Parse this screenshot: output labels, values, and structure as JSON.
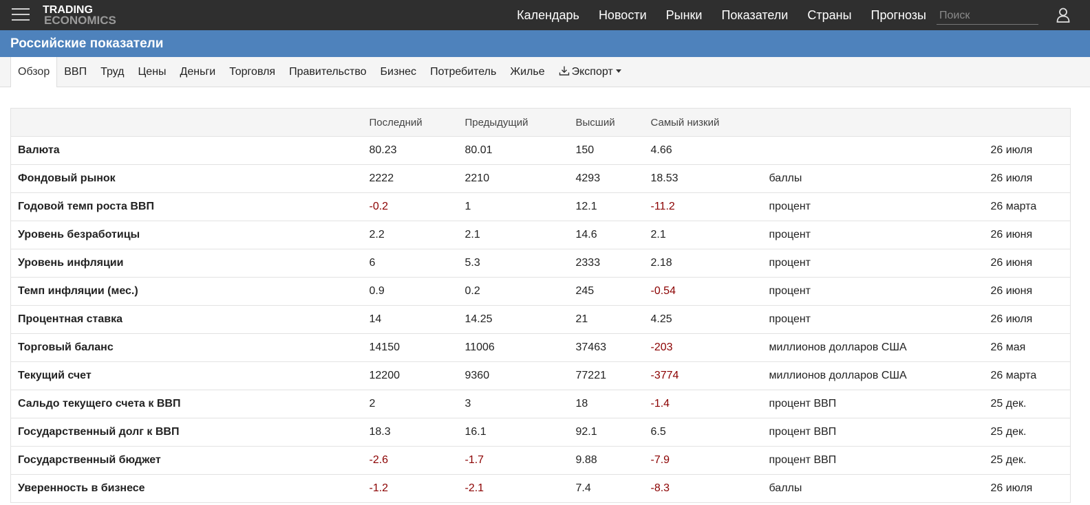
{
  "topbar": {
    "logo_line1": "TRADING",
    "logo_line2": "ECONOMICS",
    "nav": [
      "Календарь",
      "Новости",
      "Рынки",
      "Показатели",
      "Страны",
      "Прогнозы"
    ],
    "search_placeholder": "Поиск",
    "icons": {
      "menu": "hamburger-menu-icon",
      "user": "user-icon"
    }
  },
  "title": "Российские показатели",
  "subnav": {
    "tabs": [
      "Обзор",
      "ВВП",
      "Труд",
      "Цены",
      "Деньги",
      "Торговля",
      "Правительство",
      "Бизнес",
      "Потребитель",
      "Жилье"
    ],
    "active": "Обзор",
    "export_label": "Экспорт",
    "export_icon": "download-icon"
  },
  "table": {
    "headers": [
      "",
      "Последний",
      "Предыдущий",
      "Высший",
      "Самый низкий",
      "",
      ""
    ],
    "negative_color": "#8b0000",
    "rows": [
      {
        "name": "Валюта",
        "last": "80.23",
        "prev": "80.01",
        "high": "150",
        "low": "4.66",
        "unit": "",
        "date": "26 июля"
      },
      {
        "name": "Фондовый рынок",
        "last": "2222",
        "prev": "2210",
        "high": "4293",
        "low": "18.53",
        "unit": "баллы",
        "date": "26 июля"
      },
      {
        "name": "Годовой темп роста ВВП",
        "last": "-0.2",
        "prev": "1",
        "high": "12.1",
        "low": "-11.2",
        "unit": "процент",
        "date": "26 марта"
      },
      {
        "name": "Уровень безработицы",
        "last": "2.2",
        "prev": "2.1",
        "high": "14.6",
        "low": "2.1",
        "unit": "процент",
        "date": "26 июня"
      },
      {
        "name": "Уровень инфляции",
        "last": "6",
        "prev": "5.3",
        "high": "2333",
        "low": "2.18",
        "unit": "процент",
        "date": "26 июня"
      },
      {
        "name": "Темп инфляции (мес.)",
        "last": "0.9",
        "prev": "0.2",
        "high": "245",
        "low": "-0.54",
        "unit": "процент",
        "date": "26 июня"
      },
      {
        "name": "Процентная ставка",
        "last": "14",
        "prev": "14.25",
        "high": "21",
        "low": "4.25",
        "unit": "процент",
        "date": "26 июля"
      },
      {
        "name": "Торговый баланс",
        "last": "14150",
        "prev": "11006",
        "high": "37463",
        "low": "-203",
        "unit": "миллионов долларов США",
        "date": "26 мая"
      },
      {
        "name": "Текущий счет",
        "last": "12200",
        "prev": "9360",
        "high": "77221",
        "low": "-3774",
        "unit": "миллионов долларов США",
        "date": "26 марта"
      },
      {
        "name": "Сальдо текущего счета к ВВП",
        "last": "2",
        "prev": "3",
        "high": "18",
        "low": "-1.4",
        "unit": "процент ВВП",
        "date": "25 дек."
      },
      {
        "name": "Государственный долг к ВВП",
        "last": "18.3",
        "prev": "16.1",
        "high": "92.1",
        "low": "6.5",
        "unit": "процент ВВП",
        "date": "25 дек."
      },
      {
        "name": "Государственный бюджет",
        "last": "-2.6",
        "prev": "-1.7",
        "high": "9.88",
        "low": "-7.9",
        "unit": "процент ВВП",
        "date": "25 дек."
      },
      {
        "name": "Уверенность в бизнесе",
        "last": "-1.2",
        "prev": "-2.1",
        "high": "7.4",
        "low": "-8.3",
        "unit": "баллы",
        "date": "26 июля"
      }
    ]
  }
}
